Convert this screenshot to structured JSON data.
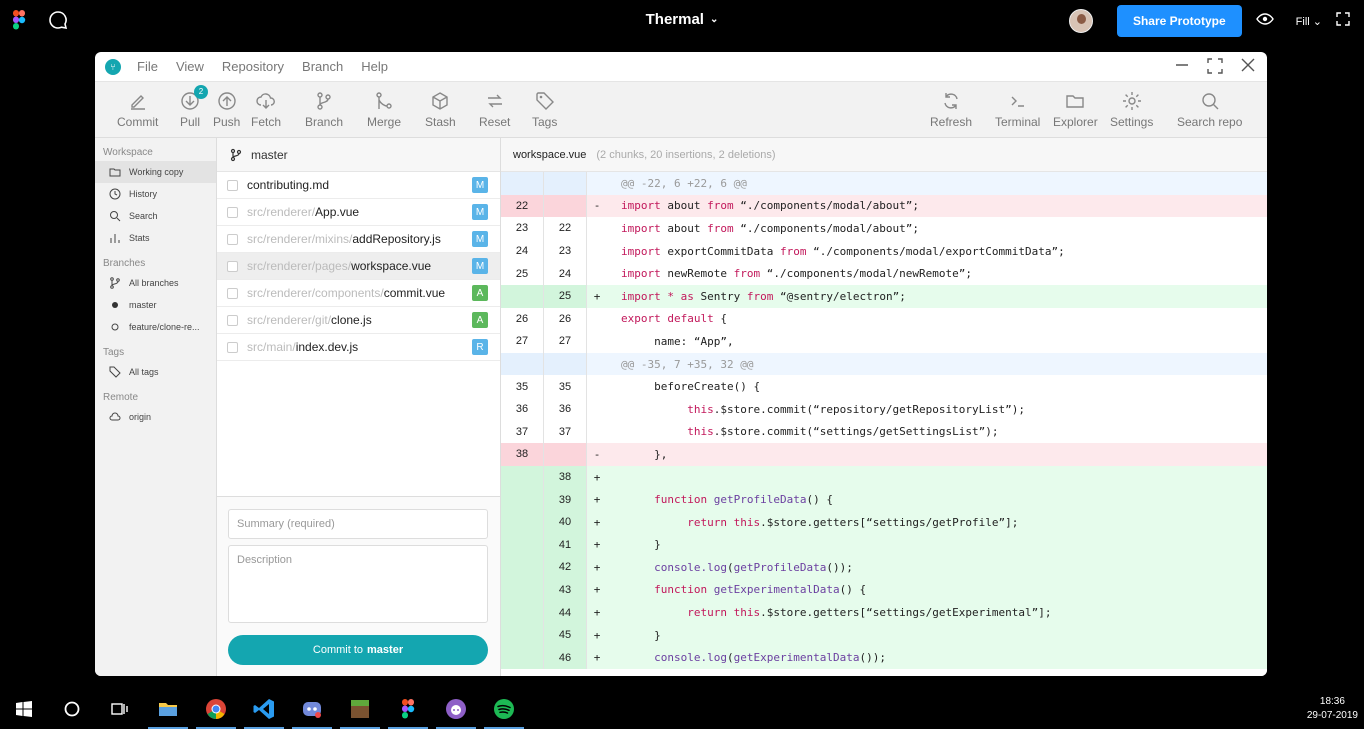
{
  "topbar": {
    "title": "Thermal",
    "share_label": "Share Prototype",
    "fill_label": "Fill"
  },
  "menubar": {
    "items": [
      "File",
      "View",
      "Repository",
      "Branch",
      "Help"
    ]
  },
  "toolbar": {
    "left": [
      {
        "label": "Commit",
        "icon": "pencil-icon"
      },
      {
        "label": "Pull",
        "icon": "pull-icon",
        "badge": "2"
      },
      {
        "label": "Push",
        "icon": "push-icon"
      },
      {
        "label": "Fetch",
        "icon": "fetch-icon"
      },
      {
        "label": "Branch",
        "icon": "branch-icon"
      },
      {
        "label": "Merge",
        "icon": "merge-icon"
      },
      {
        "label": "Stash",
        "icon": "stash-icon"
      },
      {
        "label": "Reset",
        "icon": "reset-icon"
      },
      {
        "label": "Tags",
        "icon": "tag-icon"
      }
    ],
    "right": [
      {
        "label": "Refresh",
        "icon": "refresh-icon"
      },
      {
        "label": "Terminal",
        "icon": "terminal-icon"
      },
      {
        "label": "Explorer",
        "icon": "folder-icon"
      },
      {
        "label": "Settings",
        "icon": "gear-icon"
      },
      {
        "label": "Search repo",
        "icon": "search-icon"
      }
    ]
  },
  "sidebar": {
    "workspace_heading": "Workspace",
    "workspace_items": [
      "Working copy",
      "History",
      "Search",
      "Stats"
    ],
    "branches_heading": "Branches",
    "branch_items": [
      "All branches",
      "master",
      "feature/clone-re..."
    ],
    "tags_heading": "Tags",
    "tag_items": [
      "All tags"
    ],
    "remote_heading": "Remote",
    "remote_items": [
      "origin"
    ]
  },
  "filepane": {
    "branch": "master",
    "files": [
      {
        "dir": "",
        "name": "contributing.md",
        "status": "M"
      },
      {
        "dir": "src/renderer/",
        "name": "App.vue",
        "status": "M"
      },
      {
        "dir": "src/renderer/mixins/",
        "name": "addRepository.js",
        "status": "M"
      },
      {
        "dir": "src/renderer/pages/",
        "name": "workspace.vue",
        "status": "M"
      },
      {
        "dir": "src/renderer/components/",
        "name": "commit.vue",
        "status": "A"
      },
      {
        "dir": "src/renderer/git/",
        "name": "clone.js",
        "status": "A"
      },
      {
        "dir": "src/main/",
        "name": "index.dev.js",
        "status": "R"
      }
    ],
    "summary_placeholder": "Summary (required)",
    "description_placeholder": "Description",
    "commit_label": "Commit to",
    "commit_branch": "master"
  },
  "diff": {
    "filename": "workspace.vue",
    "meta": "(2 chunks, 20 insertions, 2 deletions)",
    "rows": [
      {
        "type": "hunk",
        "old": "",
        "new": "",
        "sign": "",
        "code": "@@ -22, 6 +22, 6 @@"
      },
      {
        "type": "del",
        "old": "22",
        "new": "",
        "sign": "-",
        "code": "import about from “./components/modal/about”;"
      },
      {
        "type": "ctx",
        "old": "23",
        "new": "22",
        "sign": "",
        "code": "import about from “./components/modal/about”;"
      },
      {
        "type": "ctx",
        "old": "24",
        "new": "23",
        "sign": "",
        "code": "import exportCommitData from “./components/modal/exportCommitData”;"
      },
      {
        "type": "ctx",
        "old": "25",
        "new": "24",
        "sign": "",
        "code": "import newRemote from “./components/modal/newRemote”;"
      },
      {
        "type": "add",
        "old": "",
        "new": "25",
        "sign": "+",
        "code": "import * as Sentry from “@sentry/electron”;"
      },
      {
        "type": "ctx",
        "old": "26",
        "new": "26",
        "sign": "",
        "code": "export default {"
      },
      {
        "type": "ctx",
        "old": "27",
        "new": "27",
        "sign": "",
        "code": "     name: “App”,"
      },
      {
        "type": "hunk",
        "old": "",
        "new": "",
        "sign": "",
        "code": "@@ -35, 7 +35, 32 @@"
      },
      {
        "type": "ctx",
        "old": "35",
        "new": "35",
        "sign": "",
        "code": "     beforeCreate() {"
      },
      {
        "type": "ctx",
        "old": "36",
        "new": "36",
        "sign": "",
        "code": "          this.$store.commit(“repository/getRepositoryList”);"
      },
      {
        "type": "ctx",
        "old": "37",
        "new": "37",
        "sign": "",
        "code": "          this.$store.commit(“settings/getSettingsList”);"
      },
      {
        "type": "del",
        "old": "38",
        "new": "",
        "sign": "-",
        "code": "     },"
      },
      {
        "type": "add",
        "old": "",
        "new": "38",
        "sign": "+",
        "code": ""
      },
      {
        "type": "add",
        "old": "",
        "new": "39",
        "sign": "+",
        "code": "     function getProfileData() {"
      },
      {
        "type": "add",
        "old": "",
        "new": "40",
        "sign": "+",
        "code": "          return this.$store.getters[“settings/getProfile”];"
      },
      {
        "type": "add",
        "old": "",
        "new": "41",
        "sign": "+",
        "code": "     }"
      },
      {
        "type": "add",
        "old": "",
        "new": "42",
        "sign": "+",
        "code": "     console.log(getProfileData());"
      },
      {
        "type": "add",
        "old": "",
        "new": "43",
        "sign": "+",
        "code": "     function getExperimentalData() {"
      },
      {
        "type": "add",
        "old": "",
        "new": "44",
        "sign": "+",
        "code": "          return this.$store.getters[“settings/getExperimental”];"
      },
      {
        "type": "add",
        "old": "",
        "new": "45",
        "sign": "+",
        "code": "     }"
      },
      {
        "type": "add",
        "old": "",
        "new": "46",
        "sign": "+",
        "code": "     console.log(getExperimentalData());"
      }
    ]
  },
  "taskbar": {
    "apps": [
      "windows-start-icon",
      "cortana-icon",
      "task-view-icon",
      "file-explorer-icon",
      "chrome-icon",
      "vscode-icon",
      "discord-icon",
      "minecraft-icon",
      "figma-icon",
      "github-icon",
      "spotify-icon"
    ],
    "time": "18:36",
    "date": "29-07-2019"
  },
  "colors": {
    "accent": "#14a6b0",
    "share": "#1e90ff",
    "modified": "#5ab4e8",
    "added": "#5cb85c",
    "renamed": "#5ab4e8"
  }
}
